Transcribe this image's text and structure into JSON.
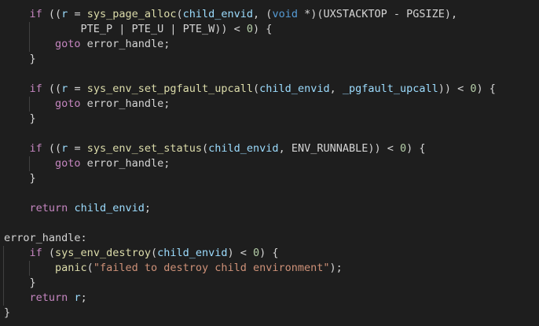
{
  "editor": {
    "language": "c",
    "theme": {
      "background": "#1e1e1e",
      "plain": "#d4d4d4",
      "keyword": "#c586c0",
      "type": "#569cd6",
      "function": "#dcdcaa",
      "variable": "#9cdcfe",
      "number": "#b5cea8",
      "string": "#ce9178",
      "indent_guide": "#404040"
    },
    "lines": [
      [
        [
          "    ",
          "pl"
        ],
        [
          "if",
          "kw"
        ],
        [
          " ((",
          "pl"
        ],
        [
          "r",
          "vr"
        ],
        [
          " = ",
          "pl"
        ],
        [
          "sys_page_alloc",
          "fn"
        ],
        [
          "(",
          "pl"
        ],
        [
          "child_envid",
          "vr"
        ],
        [
          ", (",
          "pl"
        ],
        [
          "void",
          "ty"
        ],
        [
          " *)(UXSTACKTOP - PGSIZE),",
          "pl"
        ]
      ],
      [
        [
          "            PTE_P | PTE_U | PTE_W)) < ",
          "pl"
        ],
        [
          "0",
          "nm"
        ],
        [
          ") {",
          "pl"
        ]
      ],
      [
        [
          "        ",
          "pl"
        ],
        [
          "goto",
          "kw"
        ],
        [
          " error_handle;",
          "pl"
        ]
      ],
      [
        [
          "    }",
          "pl"
        ]
      ],
      [
        [
          "",
          "pl"
        ]
      ],
      [
        [
          "    ",
          "pl"
        ],
        [
          "if",
          "kw"
        ],
        [
          " ((",
          "pl"
        ],
        [
          "r",
          "vr"
        ],
        [
          " = ",
          "pl"
        ],
        [
          "sys_env_set_pgfault_upcall",
          "fn"
        ],
        [
          "(",
          "pl"
        ],
        [
          "child_envid",
          "vr"
        ],
        [
          ", ",
          "pl"
        ],
        [
          "_pgfault_upcall",
          "vr"
        ],
        [
          ")) < ",
          "pl"
        ],
        [
          "0",
          "nm"
        ],
        [
          ") {",
          "pl"
        ]
      ],
      [
        [
          "        ",
          "pl"
        ],
        [
          "goto",
          "kw"
        ],
        [
          " error_handle;",
          "pl"
        ]
      ],
      [
        [
          "    }",
          "pl"
        ]
      ],
      [
        [
          "",
          "pl"
        ]
      ],
      [
        [
          "    ",
          "pl"
        ],
        [
          "if",
          "kw"
        ],
        [
          " ((",
          "pl"
        ],
        [
          "r",
          "vr"
        ],
        [
          " = ",
          "pl"
        ],
        [
          "sys_env_set_status",
          "fn"
        ],
        [
          "(",
          "pl"
        ],
        [
          "child_envid",
          "vr"
        ],
        [
          ", ENV_RUNNABLE)) < ",
          "pl"
        ],
        [
          "0",
          "nm"
        ],
        [
          ") {",
          "pl"
        ]
      ],
      [
        [
          "        ",
          "pl"
        ],
        [
          "goto",
          "kw"
        ],
        [
          " error_handle;",
          "pl"
        ]
      ],
      [
        [
          "    }",
          "pl"
        ]
      ],
      [
        [
          "",
          "pl"
        ]
      ],
      [
        [
          "    ",
          "pl"
        ],
        [
          "return",
          "kw"
        ],
        [
          " ",
          "pl"
        ],
        [
          "child_envid",
          "vr"
        ],
        [
          ";",
          "pl"
        ]
      ],
      [
        [
          "",
          "pl"
        ]
      ],
      [
        [
          "error_handle:",
          "pl"
        ]
      ],
      [
        [
          "    ",
          "pl"
        ],
        [
          "if",
          "kw"
        ],
        [
          " (",
          "pl"
        ],
        [
          "sys_env_destroy",
          "fn"
        ],
        [
          "(",
          "pl"
        ],
        [
          "child_envid",
          "vr"
        ],
        [
          ") < ",
          "pl"
        ],
        [
          "0",
          "nm"
        ],
        [
          ") {",
          "pl"
        ]
      ],
      [
        [
          "        ",
          "pl"
        ],
        [
          "panic",
          "fn"
        ],
        [
          "(",
          "pl"
        ],
        [
          "\"failed to destroy child environment\"",
          "st"
        ],
        [
          ");",
          "pl"
        ]
      ],
      [
        [
          "    }",
          "pl"
        ]
      ],
      [
        [
          "    ",
          "pl"
        ],
        [
          "return",
          "kw"
        ],
        [
          " ",
          "pl"
        ],
        [
          "r",
          "vr"
        ],
        [
          ";",
          "pl"
        ]
      ],
      [
        [
          "}",
          "pl"
        ]
      ]
    ]
  }
}
